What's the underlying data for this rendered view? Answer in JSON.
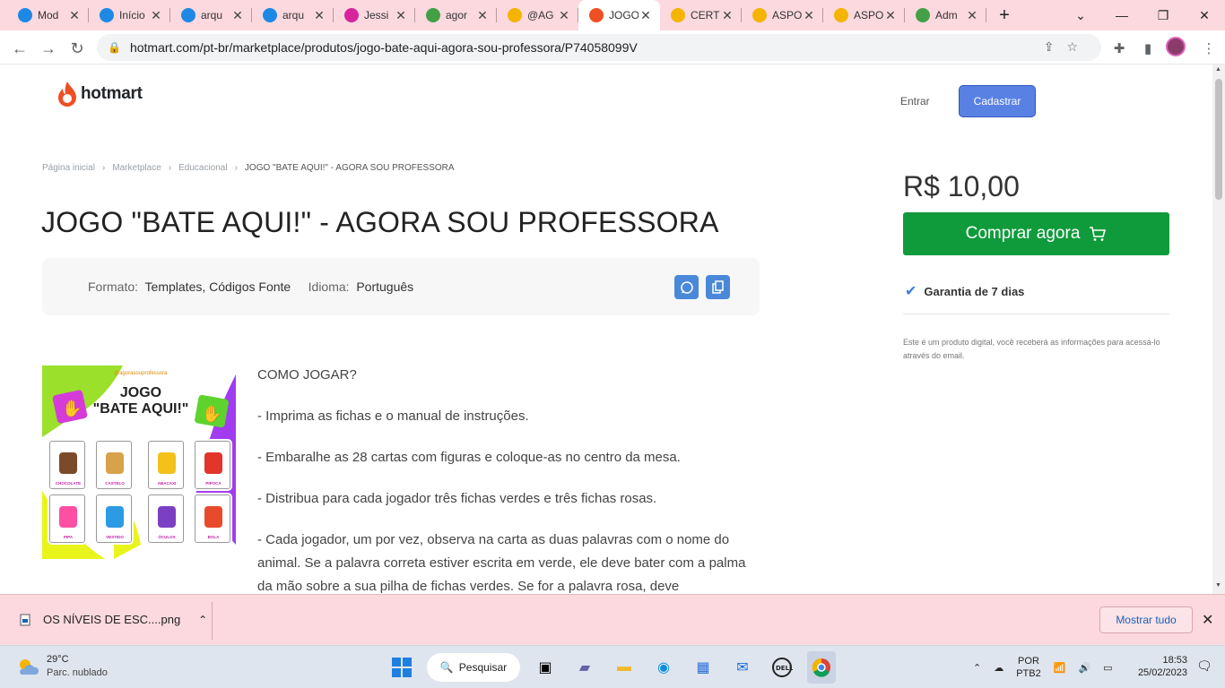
{
  "browser": {
    "tabs": [
      {
        "label": "Mod",
        "icon": "canva-icon",
        "color": "#1e88e5"
      },
      {
        "label": "Início",
        "icon": "canva-icon",
        "color": "#1e88e5"
      },
      {
        "label": "arqu",
        "icon": "canva-icon",
        "color": "#1e88e5"
      },
      {
        "label": "arqu",
        "icon": "canva-icon",
        "color": "#1e88e5"
      },
      {
        "label": "Jessi",
        "icon": "instagram-icon",
        "color": "#d6249f"
      },
      {
        "label": "agor",
        "icon": "sparkle-icon",
        "color": "#43a047"
      },
      {
        "label": "@AG",
        "icon": "drive-icon",
        "color": "#f4b400"
      },
      {
        "label": "JOGO",
        "icon": "hotmart-icon",
        "color": "#f04e23"
      },
      {
        "label": "CERT",
        "icon": "drive-icon",
        "color": "#f4b400"
      },
      {
        "label": "ASPO",
        "icon": "drive-icon",
        "color": "#f4b400"
      },
      {
        "label": "ASPO",
        "icon": "drive-icon",
        "color": "#f4b400"
      },
      {
        "label": "Adm",
        "icon": "sparkle-icon",
        "color": "#43a047"
      }
    ],
    "active_tab": 7,
    "url": "hotmart.com/pt-br/marketplace/produtos/jogo-bate-aqui-agora-sou-professora/P74058099V"
  },
  "header": {
    "logo_text": "hotmart",
    "login": "Entrar",
    "signup": "Cadastrar"
  },
  "breadcrumb": {
    "items": [
      "Página inicial",
      "Marketplace",
      "Educacional"
    ],
    "current": "JOGO \"BATE AQUI!\" - AGORA SOU PROFESSORA"
  },
  "product": {
    "title": "JOGO \"BATE AQUI!\" - AGORA SOU PROFESSORA",
    "format_label": "Formato:",
    "format_value": "Templates, Códigos Fonte",
    "language_label": "Idioma:",
    "language_value": "Português",
    "image_title": "JOGO\n\"BATE AQUI!\"",
    "image_brand": "@agorasouprofessora",
    "cards": [
      "CHOCOLATE",
      "CASTELO",
      "ABACAXI",
      "PIPOCA",
      "PIPA",
      "VESTIDO",
      "ÓCULOS",
      "BOLA"
    ],
    "description": [
      "COMO JOGAR?",
      "- Imprima as fichas e o manual de instruções.",
      "- Embaralhe as 28 cartas com figuras e coloque-as no centro da mesa.",
      "- Distribua para cada jogador três fichas verdes e três fichas rosas.",
      "- Cada jogador, um por vez, observa na carta as duas palavras com o nome do animal. Se a palavra correta estiver escrita em verde, ele deve bater com a palma da mão sobre a sua pilha de fichas verdes. Se for a palavra rosa, deve"
    ]
  },
  "purchase": {
    "price": "R$ 10,00",
    "buy_label": "Comprar agora",
    "guarantee": "Garantia de 7 dias",
    "note": "Este é um produto digital, você receberá as informações para acessá-lo através do email."
  },
  "downloads": {
    "file": "OS NÍVEIS DE ESC....png",
    "show_all": "Mostrar tudo"
  },
  "taskbar": {
    "temp": "29°C",
    "weather": "Parc. nublado",
    "search": "Pesquisar",
    "lang1": "POR",
    "lang2": "PTB2",
    "time": "18:53",
    "date": "25/02/2023"
  },
  "colors": {
    "accent_blue": "#5981e3",
    "buy_green": "#0f9b3b",
    "brand_orange": "#f04e23",
    "tabbar_pink": "#fbd9df"
  }
}
